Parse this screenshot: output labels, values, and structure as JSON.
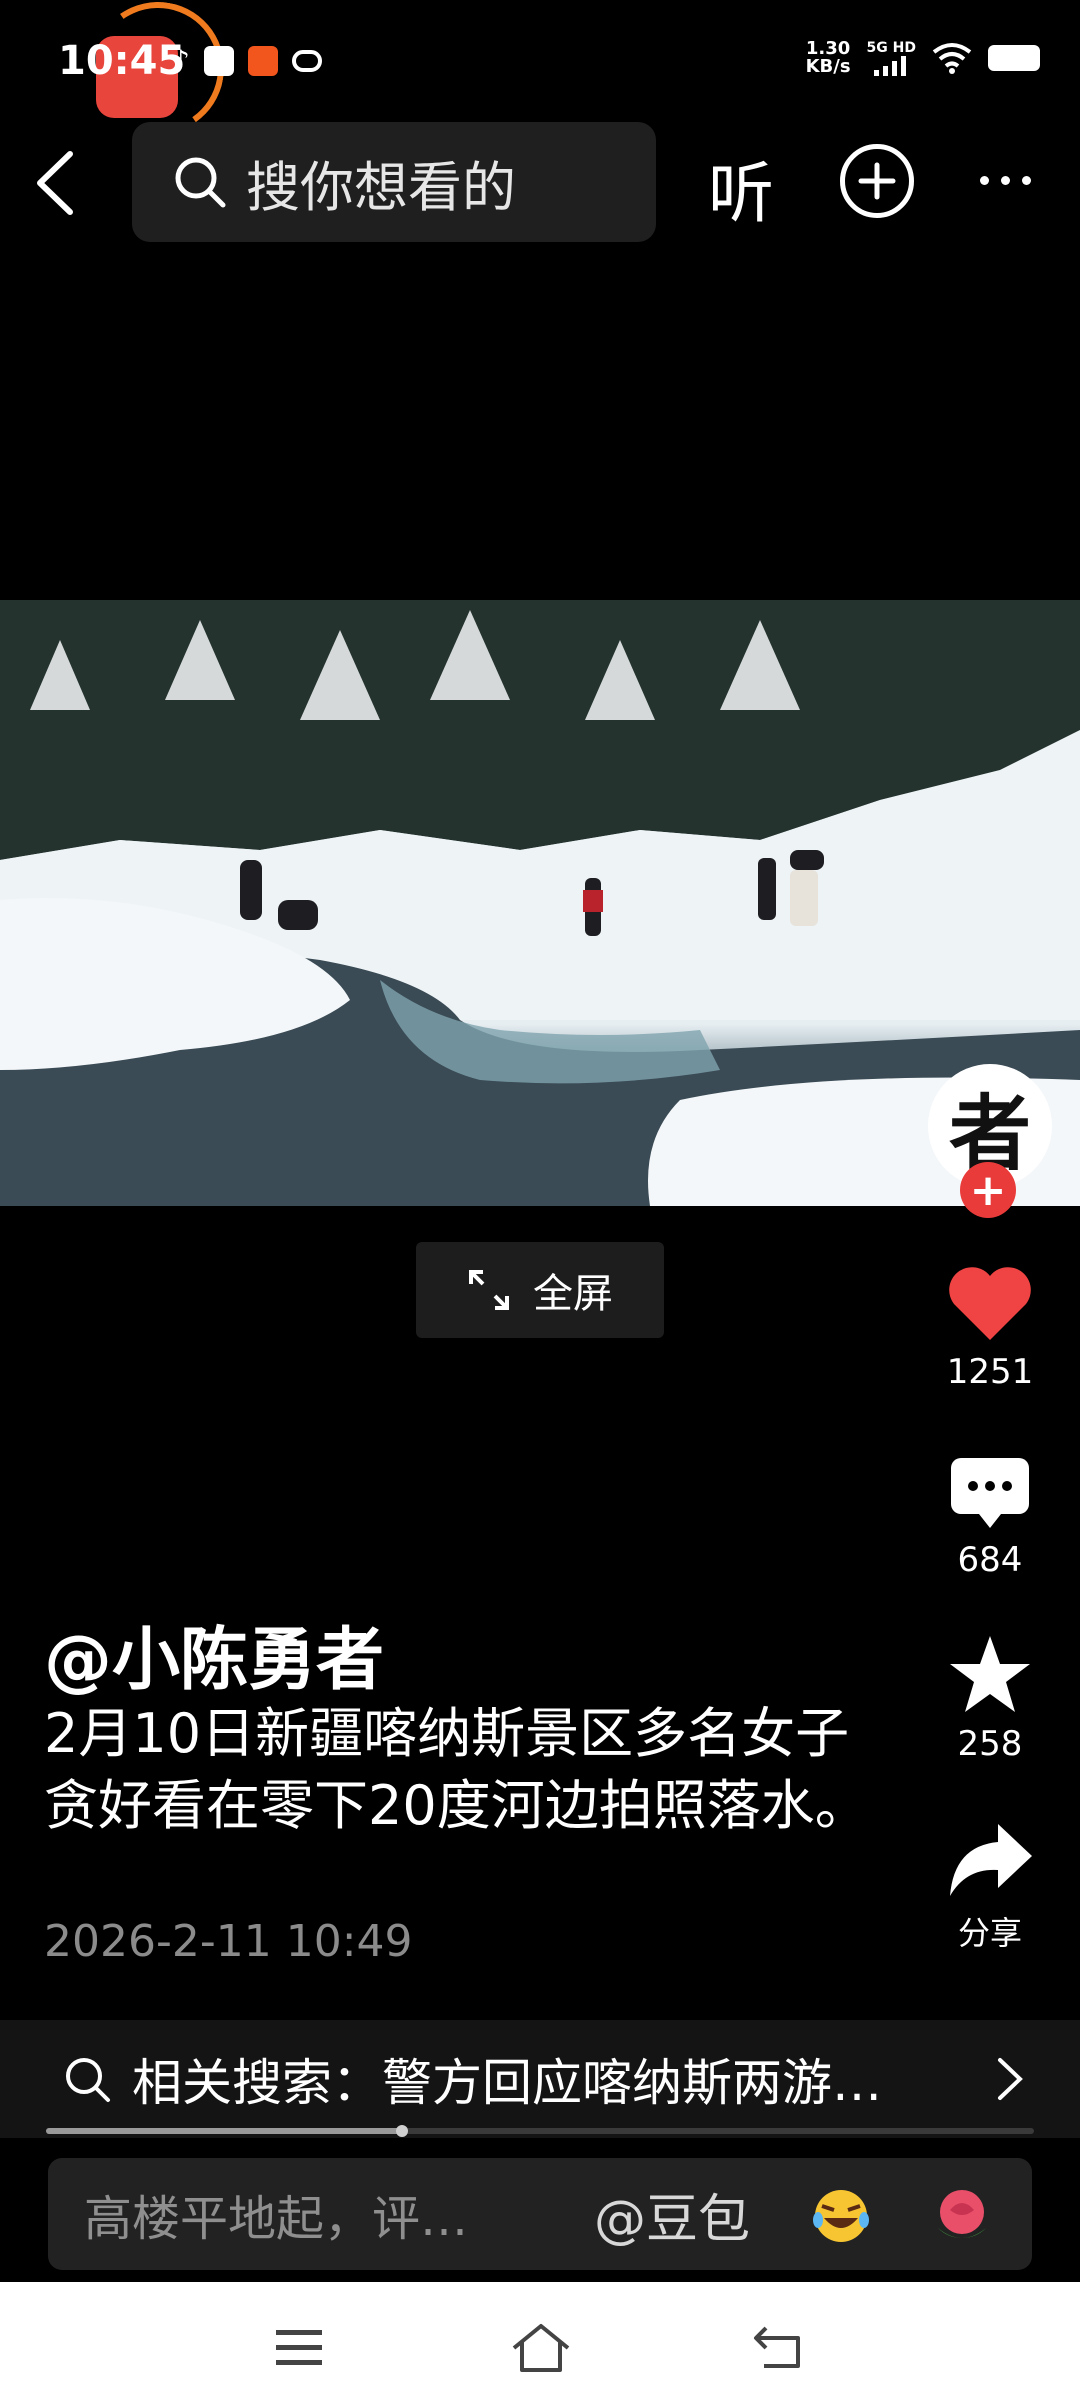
{
  "status_bar": {
    "time": "10:45",
    "net_speed_value": "1.30",
    "net_speed_unit": "KB/s",
    "network": "5G HD",
    "icons": [
      "tiktok-icon",
      "mail-icon",
      "taobao-icon",
      "app-icon",
      "signal-icon",
      "wifi-icon",
      "battery-icon"
    ]
  },
  "top_nav": {
    "search_placeholder": "搜你想看的",
    "listen_label": "听"
  },
  "video": {
    "fullscreen_label": "全屏"
  },
  "actions": {
    "avatar_glyph": "者",
    "likes": "1251",
    "comments": "684",
    "favorites": "258",
    "share_label": "分享",
    "like_color": "#f04343"
  },
  "post": {
    "username": "@小陈勇者",
    "caption": "2月10日新疆喀纳斯景区多名女子贪好看在零下20度河边拍照落水。",
    "timestamp": "2026-2-11 10:49"
  },
  "related_search": {
    "text": "相关搜索：警方回应喀纳斯两游…",
    "progress": 0.36
  },
  "comment_bar": {
    "placeholder": "高楼平地起，评…",
    "mention": "@豆包"
  }
}
